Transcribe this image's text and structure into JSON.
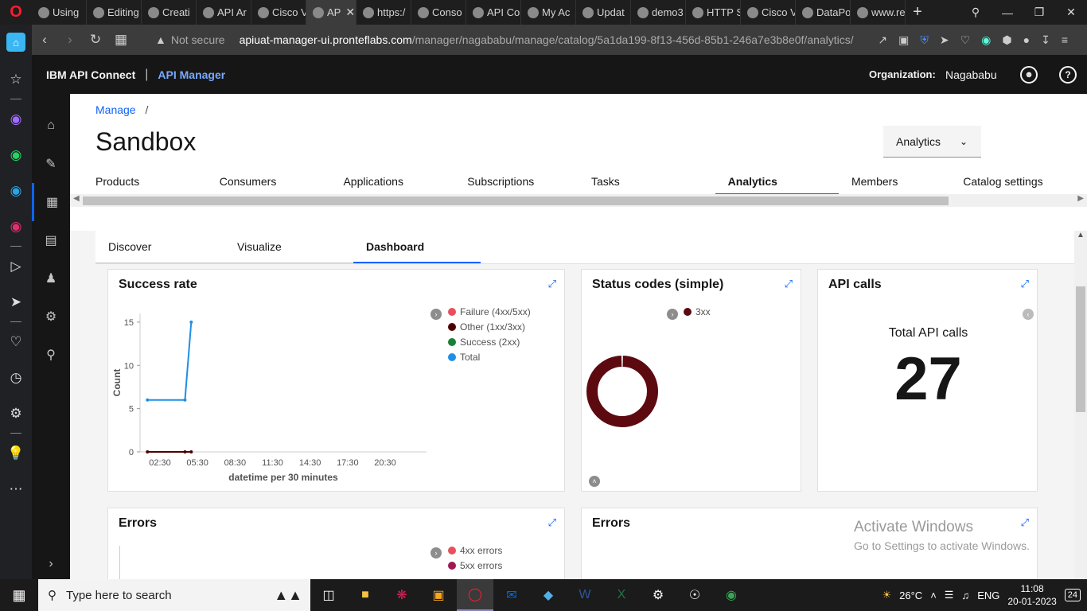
{
  "browser": {
    "tabs": [
      {
        "label": "Using",
        "active": false
      },
      {
        "label": "Editing",
        "active": false
      },
      {
        "label": "Creati",
        "active": false
      },
      {
        "label": "API Ar",
        "active": false
      },
      {
        "label": "Cisco V",
        "active": false
      },
      {
        "label": "AP",
        "active": true
      },
      {
        "label": "https:/",
        "active": false
      },
      {
        "label": "Conso",
        "active": false
      },
      {
        "label": "API Co",
        "active": false
      },
      {
        "label": "My Ac",
        "active": false
      },
      {
        "label": "Updat",
        "active": false
      },
      {
        "label": "demo3",
        "active": false
      },
      {
        "label": "HTTP S",
        "active": false
      },
      {
        "label": "Cisco V",
        "active": false
      },
      {
        "label": "DataPo",
        "active": false
      },
      {
        "label": "www.re",
        "active": false
      }
    ],
    "not_secure": "Not secure",
    "url_host": "apiuat-manager-ui.pronteflabs.com",
    "url_path": "/manager/nagababu/manage/catalog/5a1da199-8f13-456d-85b1-246a7e3b8e0f/analytics/"
  },
  "header": {
    "brand": "IBM API Connect",
    "divider": "|",
    "product": "API Manager",
    "org_label": "Organization:",
    "org_value": "Nagababu"
  },
  "breadcrumb": {
    "link": "Manage",
    "sep": "/"
  },
  "page_title": "Sandbox",
  "view_dropdown": {
    "selected": "Analytics"
  },
  "catalog_tabs": [
    "Products",
    "Consumers",
    "Applications",
    "Subscriptions",
    "Tasks",
    "Analytics",
    "Members",
    "Catalog settings"
  ],
  "sub_tabs": [
    "Discover",
    "Visualize",
    "Dashboard"
  ],
  "panels": {
    "success_rate": {
      "title": "Success rate",
      "legend": [
        {
          "label": "Failure (4xx/5xx)",
          "color": "#e8505b"
        },
        {
          "label": "Other (1xx/3xx)",
          "color": "#4d0000"
        },
        {
          "label": "Success (2xx)",
          "color": "#198038"
        },
        {
          "label": "Total",
          "color": "#1f8fe5"
        }
      ]
    },
    "status_codes": {
      "title": "Status codes (simple)",
      "legend": [
        {
          "label": "3xx",
          "color": "#5c0a10"
        }
      ]
    },
    "api_calls": {
      "title": "API calls",
      "total_label": "Total API calls",
      "total_value": "27"
    },
    "errors_1": {
      "title": "Errors",
      "legend": [
        {
          "label": "4xx errors",
          "color": "#e8505b"
        },
        {
          "label": "5xx errors",
          "color": "#9f1853"
        }
      ]
    },
    "errors_2": {
      "title": "Errors"
    }
  },
  "chart_data": [
    {
      "type": "line",
      "title": "Success rate",
      "xlabel": "datetime per 30 minutes",
      "ylabel": "Count",
      "x_ticks": [
        "02:30",
        "05:30",
        "08:30",
        "11:30",
        "14:30",
        "17:30",
        "20:30"
      ],
      "y_ticks": [
        0,
        5,
        10,
        15
      ],
      "ylim": [
        0,
        16
      ],
      "series": [
        {
          "name": "Total",
          "color": "#1f8fe5",
          "x": [
            "01:30",
            "04:30",
            "05:00"
          ],
          "y": [
            6,
            6,
            15
          ]
        },
        {
          "name": "Other (1xx/3xx)",
          "color": "#4d0000",
          "x": [
            "01:30",
            "04:30",
            "05:00"
          ],
          "y": [
            0,
            0,
            0
          ]
        }
      ]
    },
    {
      "type": "pie",
      "title": "Status codes (simple)",
      "labels": [
        "3xx"
      ],
      "values": [
        27
      ],
      "colors": [
        "#5c0a10"
      ],
      "donut": true
    }
  ],
  "activate_windows": {
    "title": "Activate Windows",
    "subtitle": "Go to Settings to activate Windows."
  },
  "taskbar": {
    "search_placeholder": "Type here to search",
    "weather": "26°C",
    "lang": "ENG",
    "time": "11:08",
    "date": "20-01-2023",
    "notif_count": "24"
  }
}
